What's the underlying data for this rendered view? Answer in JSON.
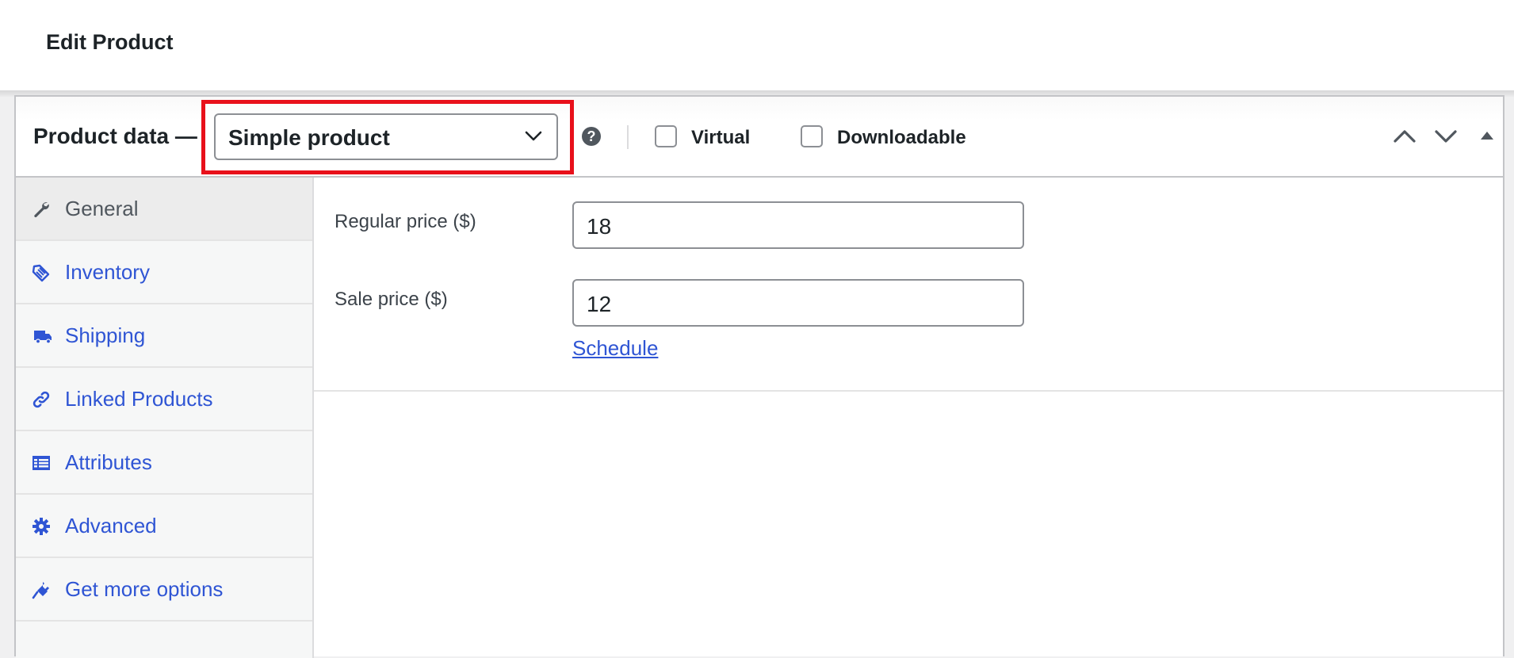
{
  "page": {
    "title": "Edit Product"
  },
  "product_data": {
    "title": "Product data —",
    "product_type": {
      "selected": "Simple product"
    },
    "help_icon": "?",
    "options": [
      {
        "label": "Virtual",
        "checked": false
      },
      {
        "label": "Downloadable",
        "checked": false
      }
    ],
    "controls": [
      "move-up-icon",
      "move-down-icon",
      "toggle-panel-icon"
    ]
  },
  "tabs": [
    {
      "label": "General",
      "icon": "wrench-icon",
      "active": true
    },
    {
      "label": "Inventory",
      "icon": "tag-icon",
      "active": false
    },
    {
      "label": "Shipping",
      "icon": "truck-icon",
      "active": false
    },
    {
      "label": "Linked Products",
      "icon": "link-icon",
      "active": false
    },
    {
      "label": "Attributes",
      "icon": "list-icon",
      "active": false
    },
    {
      "label": "Advanced",
      "icon": "gear-icon",
      "active": false
    },
    {
      "label": "Get more options",
      "icon": "plugin-icon",
      "active": false
    }
  ],
  "general": {
    "regular_price": {
      "label": "Regular price ($)",
      "value": "18"
    },
    "sale_price": {
      "label": "Sale price ($)",
      "value": "12"
    },
    "schedule_link": "Schedule"
  },
  "colors": {
    "accent_link": "#2f55d4",
    "highlight": "#e8101a"
  }
}
